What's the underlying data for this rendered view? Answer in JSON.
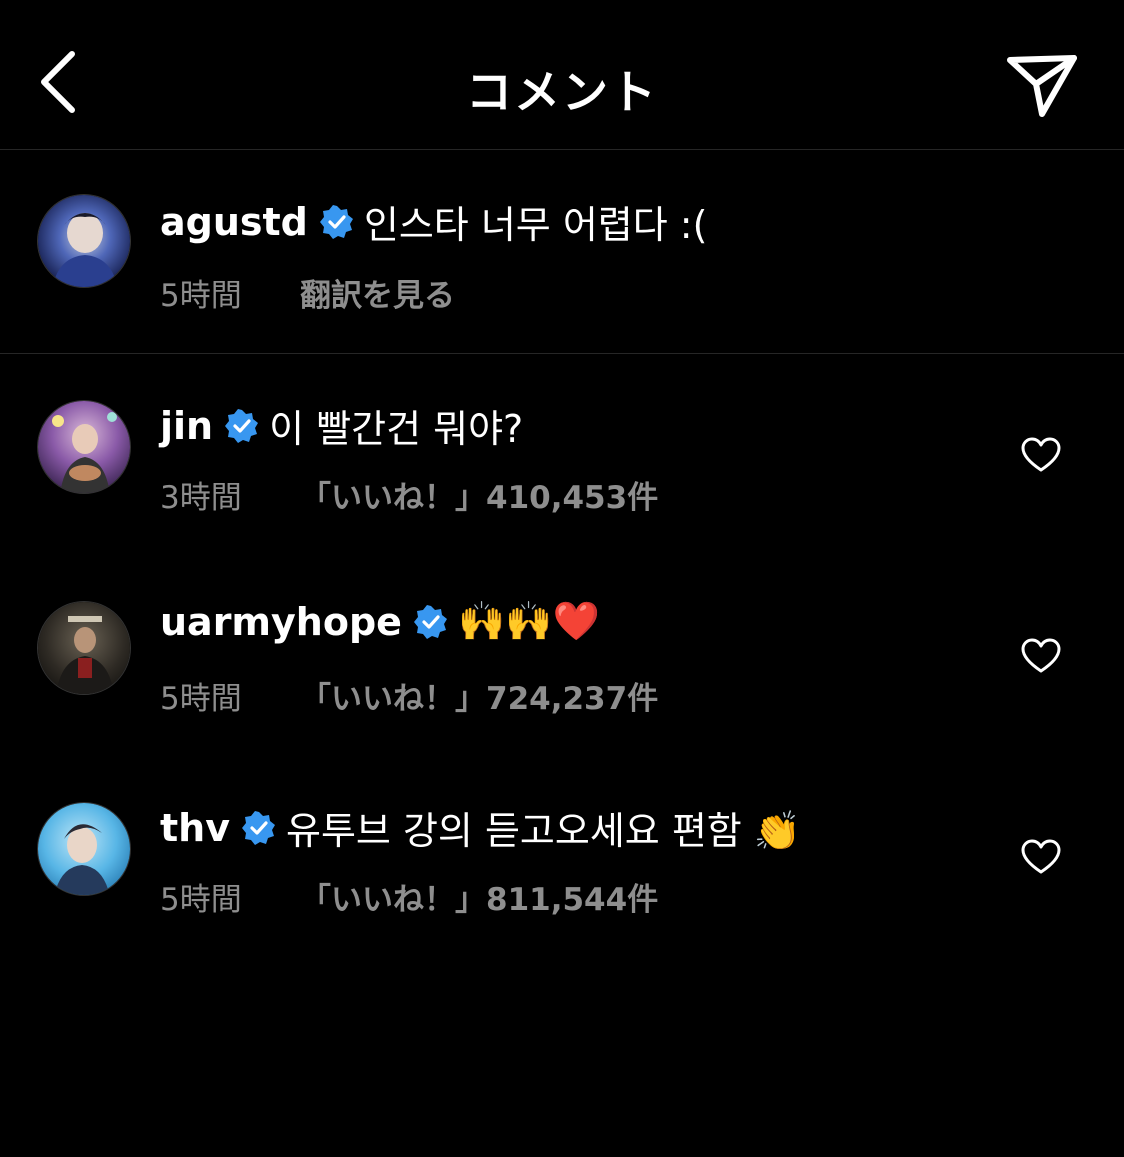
{
  "header": {
    "title": "コメント"
  },
  "caption": {
    "username": "agustd",
    "text": "인스타 너무 어렵다 :(",
    "time": "5時間",
    "translate_label": "翻訳を見る"
  },
  "comments": [
    {
      "username": "jin",
      "text": "이 빨간건 뭐야?",
      "time": "3時間",
      "likes": "「いいね！」410,453件"
    },
    {
      "username": "uarmyhope",
      "text": "🙌🙌❤️",
      "time": "5時間",
      "likes": "「いいね！」724,237件"
    },
    {
      "username": "thv",
      "text": "유투브 강의 듣고오세요 편함 👏",
      "time": "5時間",
      "likes": "「いいね！」811,544件"
    }
  ],
  "colors": {
    "background": "#000000",
    "verified_badge": "#3897f0",
    "secondary_text": "#8e8e8e",
    "divider": "#262626"
  },
  "icons": {
    "back": "chevron-left-icon",
    "share": "paper-plane-icon",
    "verified": "verified-badge-icon",
    "like": "heart-outline-icon"
  }
}
